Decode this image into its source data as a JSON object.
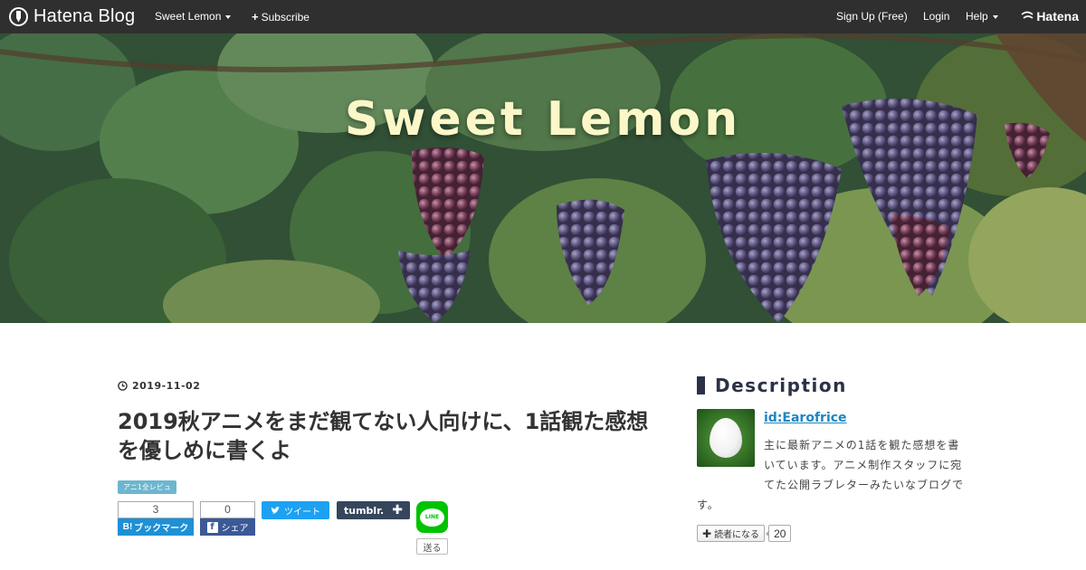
{
  "topbar": {
    "brand": "Hatena Blog",
    "blog_menu": "Sweet Lemon",
    "subscribe": "Subscribe",
    "signup": "Sign Up (Free)",
    "login": "Login",
    "help": "Help",
    "hatena": "Hatena"
  },
  "header": {
    "blog_title": "Sweet Lemon"
  },
  "entry": {
    "date": "2019-11-02",
    "title": "2019秋アニメをまだ観てない人向けに、1話観た感想を優しめに書くよ",
    "category": "アニ1全レビュ"
  },
  "share": {
    "bookmark_count": "3",
    "bookmark_label": "ブックマーク",
    "facebook_count": "0",
    "facebook_label": "シェア",
    "tweet_label": "ツイート",
    "tumblr_label": "tumblr.",
    "line_label": "LINE",
    "line_send": "送る"
  },
  "sidebar": {
    "heading": "Description",
    "profile_id": "id:Earofrice",
    "description_lines": [
      "主に最新アニメの1話を観た感想を書",
      "いています。アニメ制作スタッフに宛",
      "てた公開ラブレターみたいなブログで",
      "す。"
    ],
    "subscribe_label": "読者になる",
    "subscriber_count": "20"
  },
  "colors": {
    "topbar": "#2f2f2f",
    "title_text": "#fbf7c8",
    "category_bg": "#6db6cf",
    "hatebu": "#1e90d6",
    "facebook": "#3b5998",
    "twitter": "#1da1f2",
    "tumblr": "#35465c",
    "line": "#00c300",
    "profile_link": "#1e86bf",
    "heading": "#2c3147"
  }
}
